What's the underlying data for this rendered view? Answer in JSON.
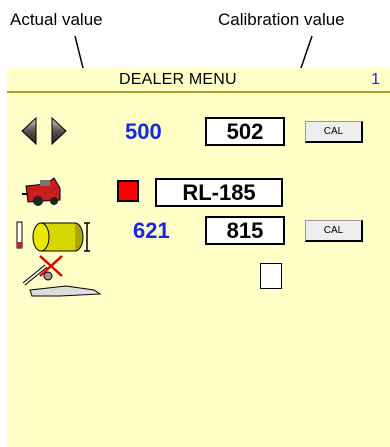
{
  "callouts": {
    "actual": "Actual value",
    "calibration": "Calibration value"
  },
  "screen": {
    "title": "DEALER MENU",
    "page_number": "1",
    "colors": {
      "background": "#ffffc8",
      "value_blue": "#1428e6",
      "indicator_red": "#ff0000"
    }
  },
  "rows": [
    {
      "icon": "steering-arrows-icon",
      "actual": "500",
      "calibration": "502",
      "button": "CAL"
    },
    {
      "icon": "baler-icon",
      "indicator": "red",
      "model": "RL-185"
    },
    {
      "icon": "bale-diameter-icon",
      "actual": "621",
      "calibration": "815",
      "button": "CAL"
    },
    {
      "icon": "disabled-tool-icon",
      "checkbox_checked": false
    }
  ]
}
